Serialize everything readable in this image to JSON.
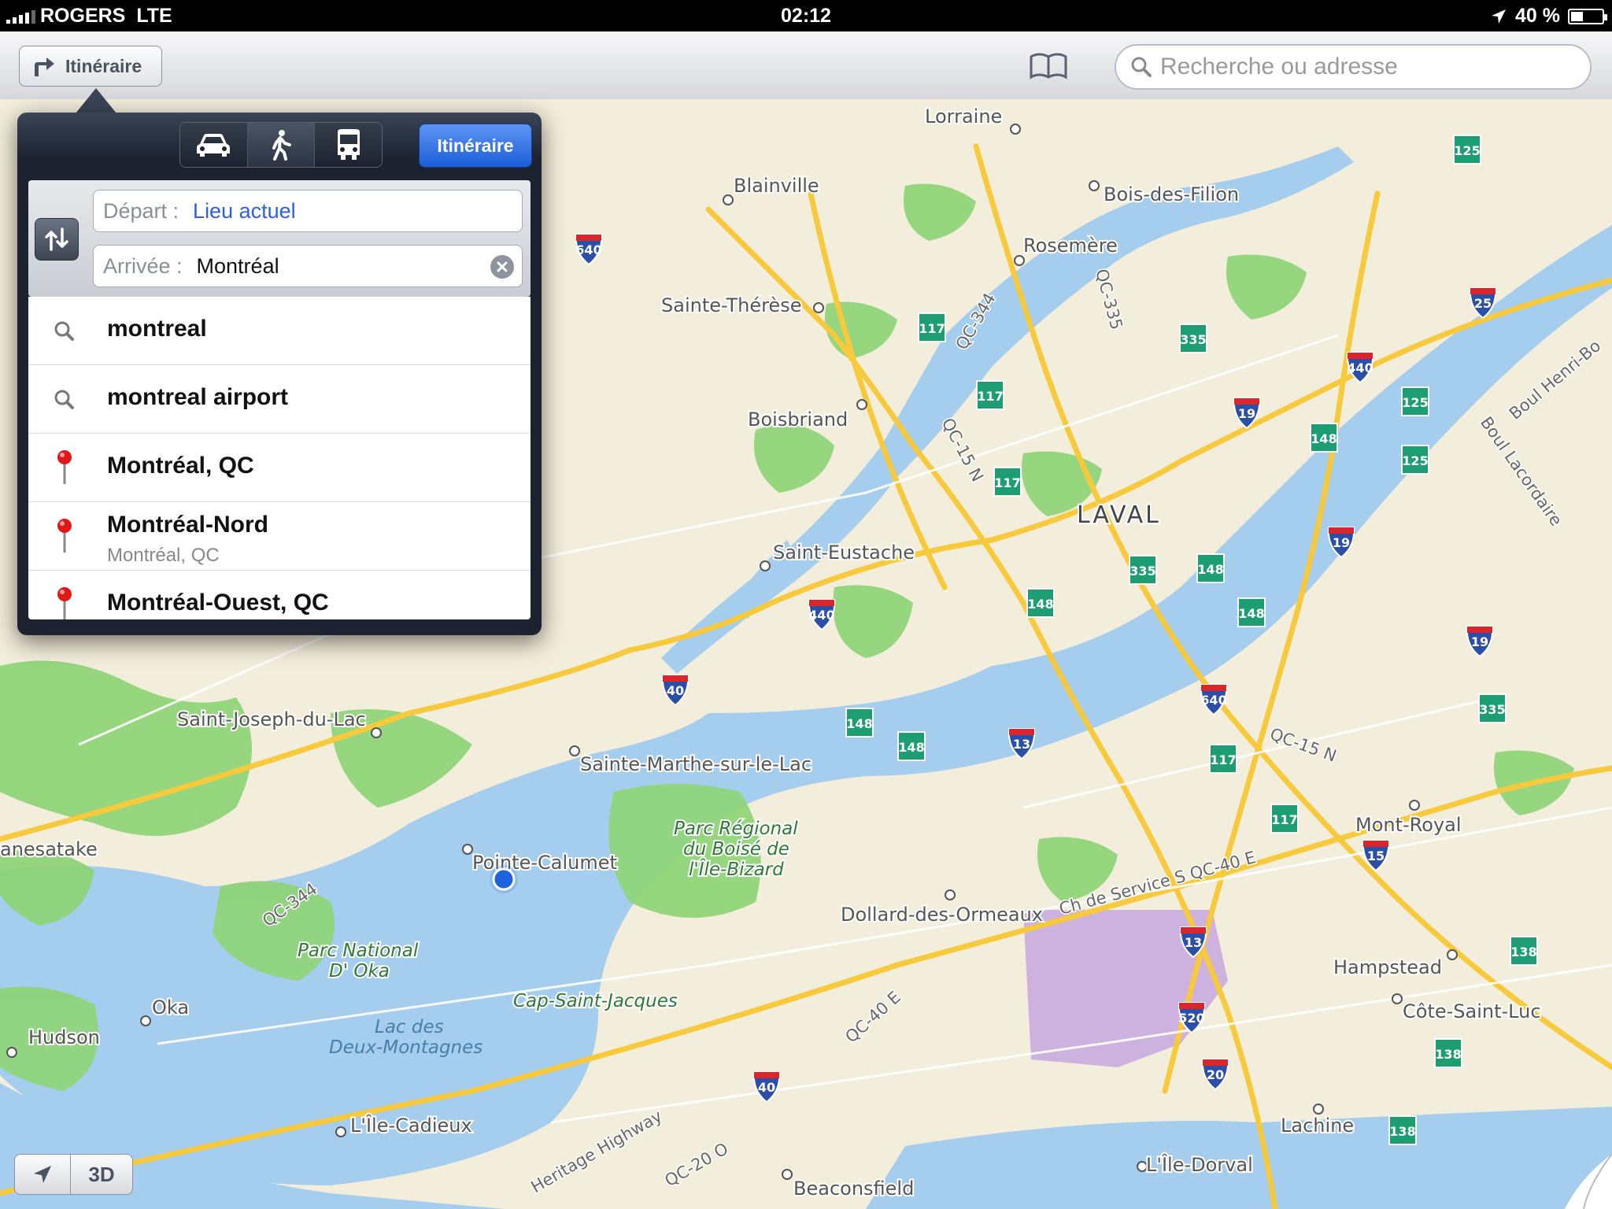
{
  "status_bar": {
    "carrier": "ROGERS",
    "network": "LTE",
    "time": "02:12",
    "battery": "40 %",
    "battery_level": 0.4
  },
  "toolbar": {
    "directions_label": "Itinéraire",
    "search_placeholder": "Recherche ou adresse"
  },
  "directions": {
    "modes": [
      {
        "name": "car-icon",
        "selected": false
      },
      {
        "name": "walk-icon",
        "selected": true
      },
      {
        "name": "bus-icon",
        "selected": false
      }
    ],
    "route_button": "Itinéraire",
    "start_label": "Départ :",
    "start_value": "Lieu actuel",
    "end_label": "Arrivée :",
    "end_value": "Montréal",
    "results": [
      {
        "icon": "search-icon",
        "title": "montreal",
        "subtitle": ""
      },
      {
        "icon": "search-icon",
        "title": "montreal airport",
        "subtitle": ""
      },
      {
        "icon": "pin-icon",
        "title": "Montréal, QC",
        "subtitle": ""
      },
      {
        "icon": "pin-icon",
        "title": "Montréal-Nord",
        "subtitle": "Montréal, QC"
      },
      {
        "icon": "pin-icon",
        "title": "Montréal-Ouest, QC",
        "subtitle": ""
      }
    ]
  },
  "map": {
    "places": [
      "Lorraine",
      "Blainville",
      "Bois-des-Filion",
      "Rosemère",
      "Sainte-Thérèse",
      "Boisbriand",
      "LAVAL",
      "Saint-Eustache",
      "Saint-Joseph-du-Lac",
      "Sainte-Marthe-sur-le-Lac",
      "Pointe-Calumet",
      "anesatake",
      "Mont-Royal",
      "Dollard-des-Ormeaux",
      "Hampstead",
      "Côte-Saint-Luc",
      "Oka",
      "Hudson",
      "Lachine",
      "L'Île-Cadieux",
      "L'Île-Dorval",
      "Beaconsfield",
      "Cap-Saint-Jacques"
    ],
    "parks": [
      "Parc Régional",
      "du Boisé de",
      "l'Île-Bizard",
      "Parc National",
      "D' Oka"
    ],
    "water": [
      "Lac des",
      "Deux-Montagnes"
    ],
    "roads": [
      "QC-344",
      "QC-335",
      "QC-15 N",
      "QC-344",
      "QC-15 N",
      "Ch de Service S QC-40 E",
      "QC-40 E",
      "QC-20 O",
      "Heritage Highway",
      "Boul Henri-Bo",
      "Boul Lacordaire"
    ],
    "shields": [
      "640",
      "125",
      "25",
      "117",
      "335",
      "440",
      "125",
      "117",
      "19",
      "148",
      "125",
      "117",
      "19",
      "148",
      "335",
      "148",
      "440",
      "148",
      "19",
      "40",
      "640",
      "148",
      "148",
      "13",
      "117",
      "335",
      "117",
      "15",
      "13",
      "138",
      "520",
      "40",
      "20",
      "138",
      "138"
    ]
  },
  "controls": {
    "three_d": "3D"
  },
  "colors": {
    "land": "#f3eedb",
    "water": "#a5cdee",
    "park": "#8fd47a",
    "highway": "#f7c93c",
    "accent": "#1d5fd9"
  }
}
